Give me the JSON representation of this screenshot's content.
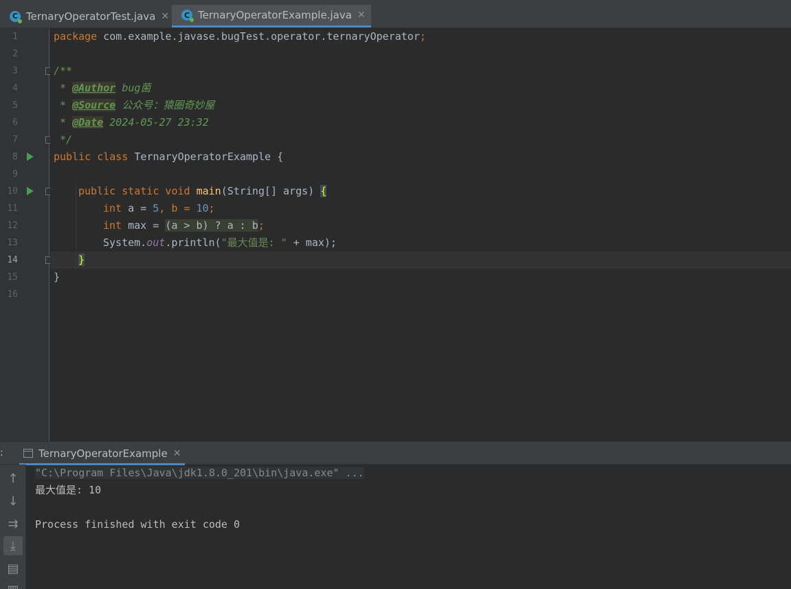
{
  "tabs": [
    {
      "label": "TernaryOperatorTest.java",
      "active": false
    },
    {
      "label": "TernaryOperatorExample.java",
      "active": true
    }
  ],
  "line_numbers": [
    "1",
    "2",
    "3",
    "4",
    "5",
    "6",
    "7",
    "8",
    "9",
    "10",
    "11",
    "12",
    "13",
    "14",
    "15",
    "16"
  ],
  "current_line": "14",
  "code": {
    "l1_kw": "package",
    "l1_pkg": " com.example.javase.bugTest.operator.ternaryOperator",
    "l1_semi": ";",
    "l3": "/**",
    "l4_star": " * ",
    "l4_tag": "@Author",
    "l4_text": " bug菌",
    "l5_star": " * ",
    "l5_tag": "@Source",
    "l5_text": " 公众号：猿圈奇妙屋",
    "l6_star": " * ",
    "l6_tag": "@Date",
    "l6_text": " 2024-05-27 23:32",
    "l7": " */",
    "l8_kw": "public class",
    "l8_rest": " TernaryOperatorExample {",
    "l10_kw": "public static void",
    "l10_fn": "main",
    "l10_rest": "(String[] args) ",
    "l10_brace": "{",
    "l11_kw": "int",
    "l11_a": " a = ",
    "l11_n1": "5",
    "l11_b": ", b = ",
    "l11_n2": "10",
    "l11_semi": ";",
    "l12_kw": "int",
    "l12_max": " max = ",
    "l12_expr": "(a > b) ? a : b",
    "l12_semi": ";",
    "l13_sys": "System.",
    "l13_out": "out",
    "l13_println": ".println(",
    "l13_str": "\"最大值是: \"",
    "l13_rest": " + max);",
    "l14_brace": "}",
    "l15": "}"
  },
  "run_panel": {
    "prefix": ":",
    "tab_label": "TernaryOperatorExample",
    "console_lines": [
      "\"C:\\Program Files\\Java\\jdk1.8.0_201\\bin\\java.exe\" ...",
      "最大值是: 10",
      "",
      "Process finished with exit code 0"
    ]
  },
  "toolbar_icons": [
    "arrow-up-icon",
    "arrow-down-icon",
    "soft-wrap-icon",
    "scroll-to-end-icon",
    "print-icon",
    "trash-icon"
  ],
  "colors": {
    "background": "#2b2b2b",
    "keyword": "#cc7832",
    "string": "#6a8759",
    "number": "#6897bb",
    "doc_comment": "#629755",
    "function": "#ffc66d",
    "accent": "#4a88c7"
  }
}
